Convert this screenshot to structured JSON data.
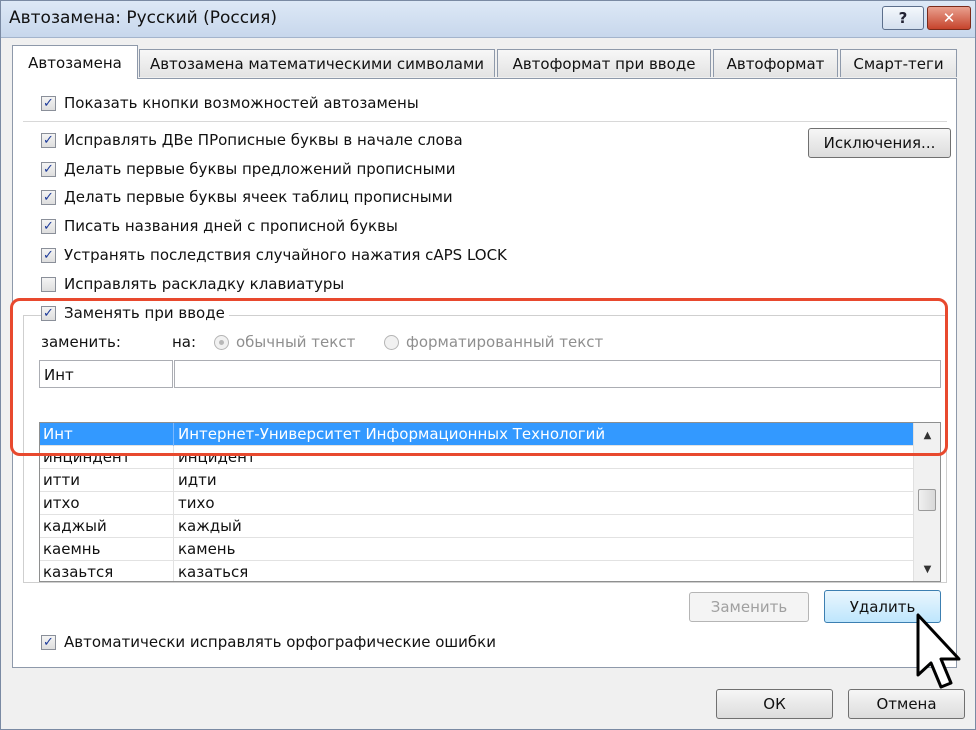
{
  "window": {
    "title": "Автозамена: Русский (Россия)",
    "help": "?",
    "close": "✕"
  },
  "tabs": [
    "Автозамена",
    "Автозамена математическими символами",
    "Автоформат при вводе",
    "Автоформат",
    "Смарт-теги"
  ],
  "options": {
    "show_buttons": {
      "label": "Показать кнопки возможностей автозамены",
      "checked": true
    },
    "two_caps": {
      "label": "Исправлять ДВе ПРописные буквы в начале слова",
      "checked": true
    },
    "sentence_caps": {
      "label": "Делать первые буквы предложений прописными",
      "checked": true
    },
    "table_caps": {
      "label": "Делать первые буквы ячеек таблиц прописными",
      "checked": true
    },
    "day_names": {
      "label": "Писать названия дней с прописной буквы",
      "checked": true
    },
    "caps_lock": {
      "label": "Устранять последствия случайного нажатия cAPS LOCK",
      "checked": true
    },
    "keyboard_layout": {
      "label": "Исправлять раскладку клавиатуры",
      "checked": false
    },
    "replace_typing": {
      "label": "Заменять при вводе",
      "checked": true
    },
    "auto_spell": {
      "label": "Автоматически исправлять орфографические ошибки",
      "checked": true
    }
  },
  "buttons": {
    "exceptions": "Исключения...",
    "replace": "Заменить",
    "delete": "Удалить",
    "ok": "ОК",
    "cancel": "Отмена"
  },
  "replace_section": {
    "replace_label": "заменить:",
    "with_label": "на:",
    "plain_text": "обычный текст",
    "formatted_text": "форматированный текст",
    "replace_value": "Инт",
    "with_value": ""
  },
  "entries": [
    {
      "from": "Инт",
      "to": "Интернет-Университет Информационных Технологий",
      "selected": true
    },
    {
      "from": "инциндент",
      "to": "инцидент",
      "selected": false
    },
    {
      "from": "итти",
      "to": "идти",
      "selected": false
    },
    {
      "from": "итхо",
      "to": "тихо",
      "selected": false
    },
    {
      "from": "каджый",
      "to": "каждый",
      "selected": false
    },
    {
      "from": "каемнь",
      "to": "камень",
      "selected": false
    },
    {
      "from": "казаьтся",
      "to": "казаться",
      "selected": false
    }
  ],
  "colors": {
    "highlight": "#e8492e",
    "selection": "#3399ff"
  },
  "icons": {
    "checkmark": "checkmark-icon",
    "scroll_up": "scroll-up-icon",
    "scroll_down": "scroll-down-icon",
    "pointer": "mouse-pointer-icon"
  }
}
